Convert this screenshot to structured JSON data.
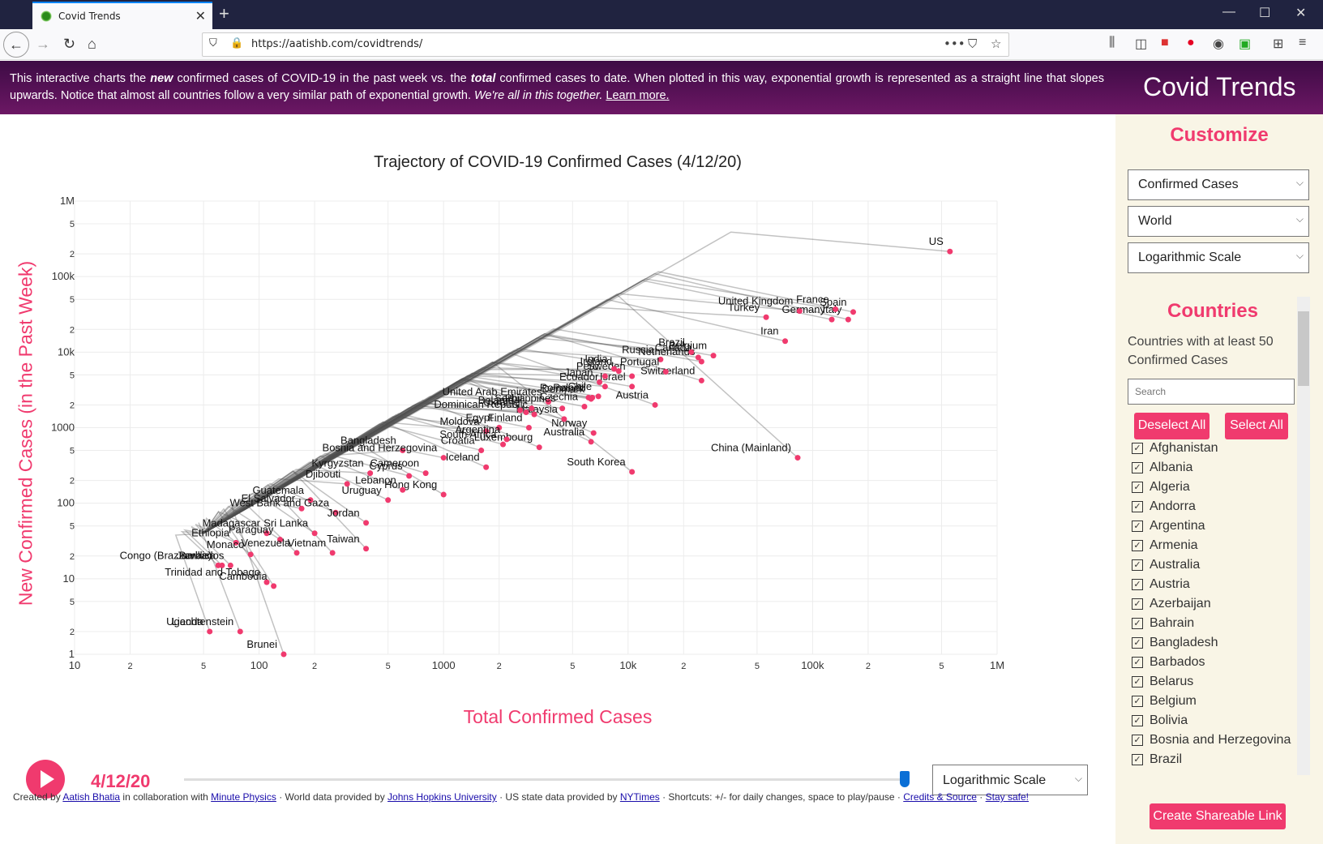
{
  "browser": {
    "tab_title": "Covid Trends",
    "url": "https://aatishb.com/covidtrends/"
  },
  "banner": {
    "text_1": "This interactive charts the ",
    "new_word": "new",
    "text_2": " confirmed cases of COVID-19 in the past week vs. the ",
    "total_word": "total",
    "text_3": " confirmed cases to date. When plotted in this way, exponential growth is represented as a straight line that slopes upwards. Notice that almost all countries follow a very similar path of exponential growth. ",
    "italic": "We're all in this together.",
    "learn_more": "Learn more.",
    "site_title": "Covid Trends"
  },
  "sidebar": {
    "customize_title": "Customize",
    "select_measure": "Confirmed Cases",
    "select_region": "World",
    "select_scale": "Logarithmic Scale",
    "countries_title": "Countries",
    "countries_desc": "Countries with at least 50 Confirmed Cases",
    "search_placeholder": "Search",
    "deselect_all": "Deselect All",
    "select_all": "Select All",
    "countries": [
      "Afghanistan",
      "Albania",
      "Algeria",
      "Andorra",
      "Argentina",
      "Armenia",
      "Australia",
      "Austria",
      "Azerbaijan",
      "Bahrain",
      "Bangladesh",
      "Barbados",
      "Belarus",
      "Belgium",
      "Bolivia",
      "Bosnia and Herzegovina",
      "Brazil"
    ],
    "share_button": "Create Shareable Link"
  },
  "controls": {
    "date": "4/12/20",
    "slider_progress": 1.0,
    "scale_select": "Logarithmic Scale"
  },
  "footer": {
    "created_by": "Created by ",
    "author": "Aatish Bhatia",
    "collab": " in collaboration with ",
    "collab_link": "Minute Physics",
    "world_data": " · World data provided by ",
    "jhu": "Johns Hopkins University",
    "us_data": " · US state data provided by ",
    "nyt": "NYTimes",
    "shortcuts": " · Shortcuts: +/- for daily changes, space to play/pause · ",
    "credits": "Credits & Source",
    "sep": " · ",
    "stay_safe": "Stay safe!"
  },
  "colors": {
    "accent": "#f03a6e",
    "banner_top": "#3d0b45",
    "banner_bottom": "#6c1764",
    "sidebar_bg": "#f9f5e6"
  },
  "chart_data": {
    "type": "scatter",
    "title": "Trajectory of COVID-19 Confirmed Cases (4/12/20)",
    "xlabel": "Total Confirmed Cases",
    "ylabel": "New Confirmed Cases (in the Past Week)",
    "xscale": "log",
    "yscale": "log",
    "xlim": [
      10,
      1000000
    ],
    "ylim": [
      1,
      1000000
    ],
    "x_ticks": [
      "10",
      "2",
      "5",
      "100",
      "2",
      "5",
      "1000",
      "2",
      "5",
      "10k",
      "2",
      "5",
      "100k",
      "2",
      "5",
      "1M"
    ],
    "y_ticks": [
      "1",
      "2",
      "5",
      "10",
      "2",
      "5",
      "100",
      "2",
      "5",
      "1000",
      "2",
      "5",
      "10k",
      "2",
      "5",
      "100k",
      "2",
      "5",
      "1M"
    ],
    "grid": true,
    "points": [
      {
        "name": "US",
        "x": 555000,
        "y": 215000
      },
      {
        "name": "Spain",
        "x": 166000,
        "y": 34000
      },
      {
        "name": "Italy",
        "x": 156000,
        "y": 27000
      },
      {
        "name": "France",
        "x": 133000,
        "y": 37000
      },
      {
        "name": "Germany",
        "x": 127000,
        "y": 27000
      },
      {
        "name": "United Kingdom",
        "x": 85000,
        "y": 35000
      },
      {
        "name": "Turkey",
        "x": 56000,
        "y": 29000
      },
      {
        "name": "Iran",
        "x": 71000,
        "y": 14000
      },
      {
        "name": "China (Mainland)",
        "x": 83000,
        "y": 400
      },
      {
        "name": "Belgium",
        "x": 29000,
        "y": 9000
      },
      {
        "name": "Netherlands",
        "x": 25000,
        "y": 7500
      },
      {
        "name": "Canada",
        "x": 24000,
        "y": 8500
      },
      {
        "name": "Brazil",
        "x": 22000,
        "y": 10000
      },
      {
        "name": "Switzerland",
        "x": 25000,
        "y": 4200
      },
      {
        "name": "Russia",
        "x": 15000,
        "y": 8000
      },
      {
        "name": "Portugal",
        "x": 16000,
        "y": 5500
      },
      {
        "name": "Austria",
        "x": 14000,
        "y": 2000
      },
      {
        "name": "Israel",
        "x": 10500,
        "y": 3500
      },
      {
        "name": "Sweden",
        "x": 10500,
        "y": 4800
      },
      {
        "name": "Ireland",
        "x": 8900,
        "y": 5600
      },
      {
        "name": "India",
        "x": 8400,
        "y": 6000
      },
      {
        "name": "Peru",
        "x": 7500,
        "y": 4800
      },
      {
        "name": "South Korea",
        "x": 10500,
        "y": 260
      },
      {
        "name": "Australia",
        "x": 6300,
        "y": 650
      },
      {
        "name": "Norway",
        "x": 6500,
        "y": 850
      },
      {
        "name": "Japan",
        "x": 7000,
        "y": 4000
      },
      {
        "name": "Ecuador",
        "x": 7500,
        "y": 3500
      },
      {
        "name": "Chile",
        "x": 6900,
        "y": 2600
      },
      {
        "name": "Denmark",
        "x": 6300,
        "y": 2400
      },
      {
        "name": "Czechia",
        "x": 5800,
        "y": 1900
      },
      {
        "name": "Poland",
        "x": 6400,
        "y": 2500
      },
      {
        "name": "Romania",
        "x": 6100,
        "y": 2500
      },
      {
        "name": "Malaysia",
        "x": 4500,
        "y": 1300
      },
      {
        "name": "Luxembourg",
        "x": 3300,
        "y": 550
      },
      {
        "name": "Dominican Republic",
        "x": 3100,
        "y": 1500
      },
      {
        "name": "United Arab Emirates",
        "x": 3700,
        "y": 2200
      },
      {
        "name": "Belarus",
        "x": 2600,
        "y": 1700
      },
      {
        "name": "Serbia",
        "x": 3000,
        "y": 1800
      },
      {
        "name": "Philippines",
        "x": 4400,
        "y": 1800
      },
      {
        "name": "Ukraine",
        "x": 2800,
        "y": 1600
      },
      {
        "name": "Finland",
        "x": 2900,
        "y": 1000
      },
      {
        "name": "Egypt",
        "x": 2000,
        "y": 1000
      },
      {
        "name": "Moldova",
        "x": 1700,
        "y": 900
      },
      {
        "name": "Argentina",
        "x": 2200,
        "y": 700
      },
      {
        "name": "South Africa",
        "x": 2100,
        "y": 600
      },
      {
        "name": "Croatia",
        "x": 1600,
        "y": 500
      },
      {
        "name": "Iceland",
        "x": 1700,
        "y": 300
      },
      {
        "name": "Bangladesh",
        "x": 600,
        "y": 500
      },
      {
        "name": "Bosnia and Herzegovina",
        "x": 1000,
        "y": 400
      },
      {
        "name": "Kyrgyzstan",
        "x": 400,
        "y": 250
      },
      {
        "name": "Cyprus",
        "x": 650,
        "y": 230
      },
      {
        "name": "Cameroon",
        "x": 800,
        "y": 250
      },
      {
        "name": "Hong Kong",
        "x": 1000,
        "y": 130
      },
      {
        "name": "Lebanon",
        "x": 600,
        "y": 150
      },
      {
        "name": "Uruguay",
        "x": 500,
        "y": 110
      },
      {
        "name": "Djibouti",
        "x": 300,
        "y": 180
      },
      {
        "name": "Guatemala",
        "x": 190,
        "y": 110
      },
      {
        "name": "El Salvador",
        "x": 170,
        "y": 85
      },
      {
        "name": "West Bank and Gaza",
        "x": 260,
        "y": 75
      },
      {
        "name": "Jordan",
        "x": 380,
        "y": 55
      },
      {
        "name": "Sri Lanka",
        "x": 200,
        "y": 40
      },
      {
        "name": "Madagascar",
        "x": 110,
        "y": 40
      },
      {
        "name": "Ethiopia",
        "x": 75,
        "y": 30
      },
      {
        "name": "Paraguay",
        "x": 130,
        "y": 33
      },
      {
        "name": "Venezuela",
        "x": 160,
        "y": 22
      },
      {
        "name": "Vietnam",
        "x": 250,
        "y": 22
      },
      {
        "name": "Taiwan",
        "x": 380,
        "y": 25
      },
      {
        "name": "Monaco",
        "x": 90,
        "y": 21
      },
      {
        "name": "Congo (Brazzaville)",
        "x": 60,
        "y": 15
      },
      {
        "name": "Barbados",
        "x": 70,
        "y": 15
      },
      {
        "name": "Jamaica",
        "x": 63,
        "y": 15
      },
      {
        "name": "Trinidad and Tobago",
        "x": 110,
        "y": 9
      },
      {
        "name": "Cambodia",
        "x": 120,
        "y": 8
      },
      {
        "name": "Liechtenstein",
        "x": 79,
        "y": 2
      },
      {
        "name": "Uganda",
        "x": 54,
        "y": 2
      },
      {
        "name": "Brunei",
        "x": 136,
        "y": 1
      }
    ]
  }
}
